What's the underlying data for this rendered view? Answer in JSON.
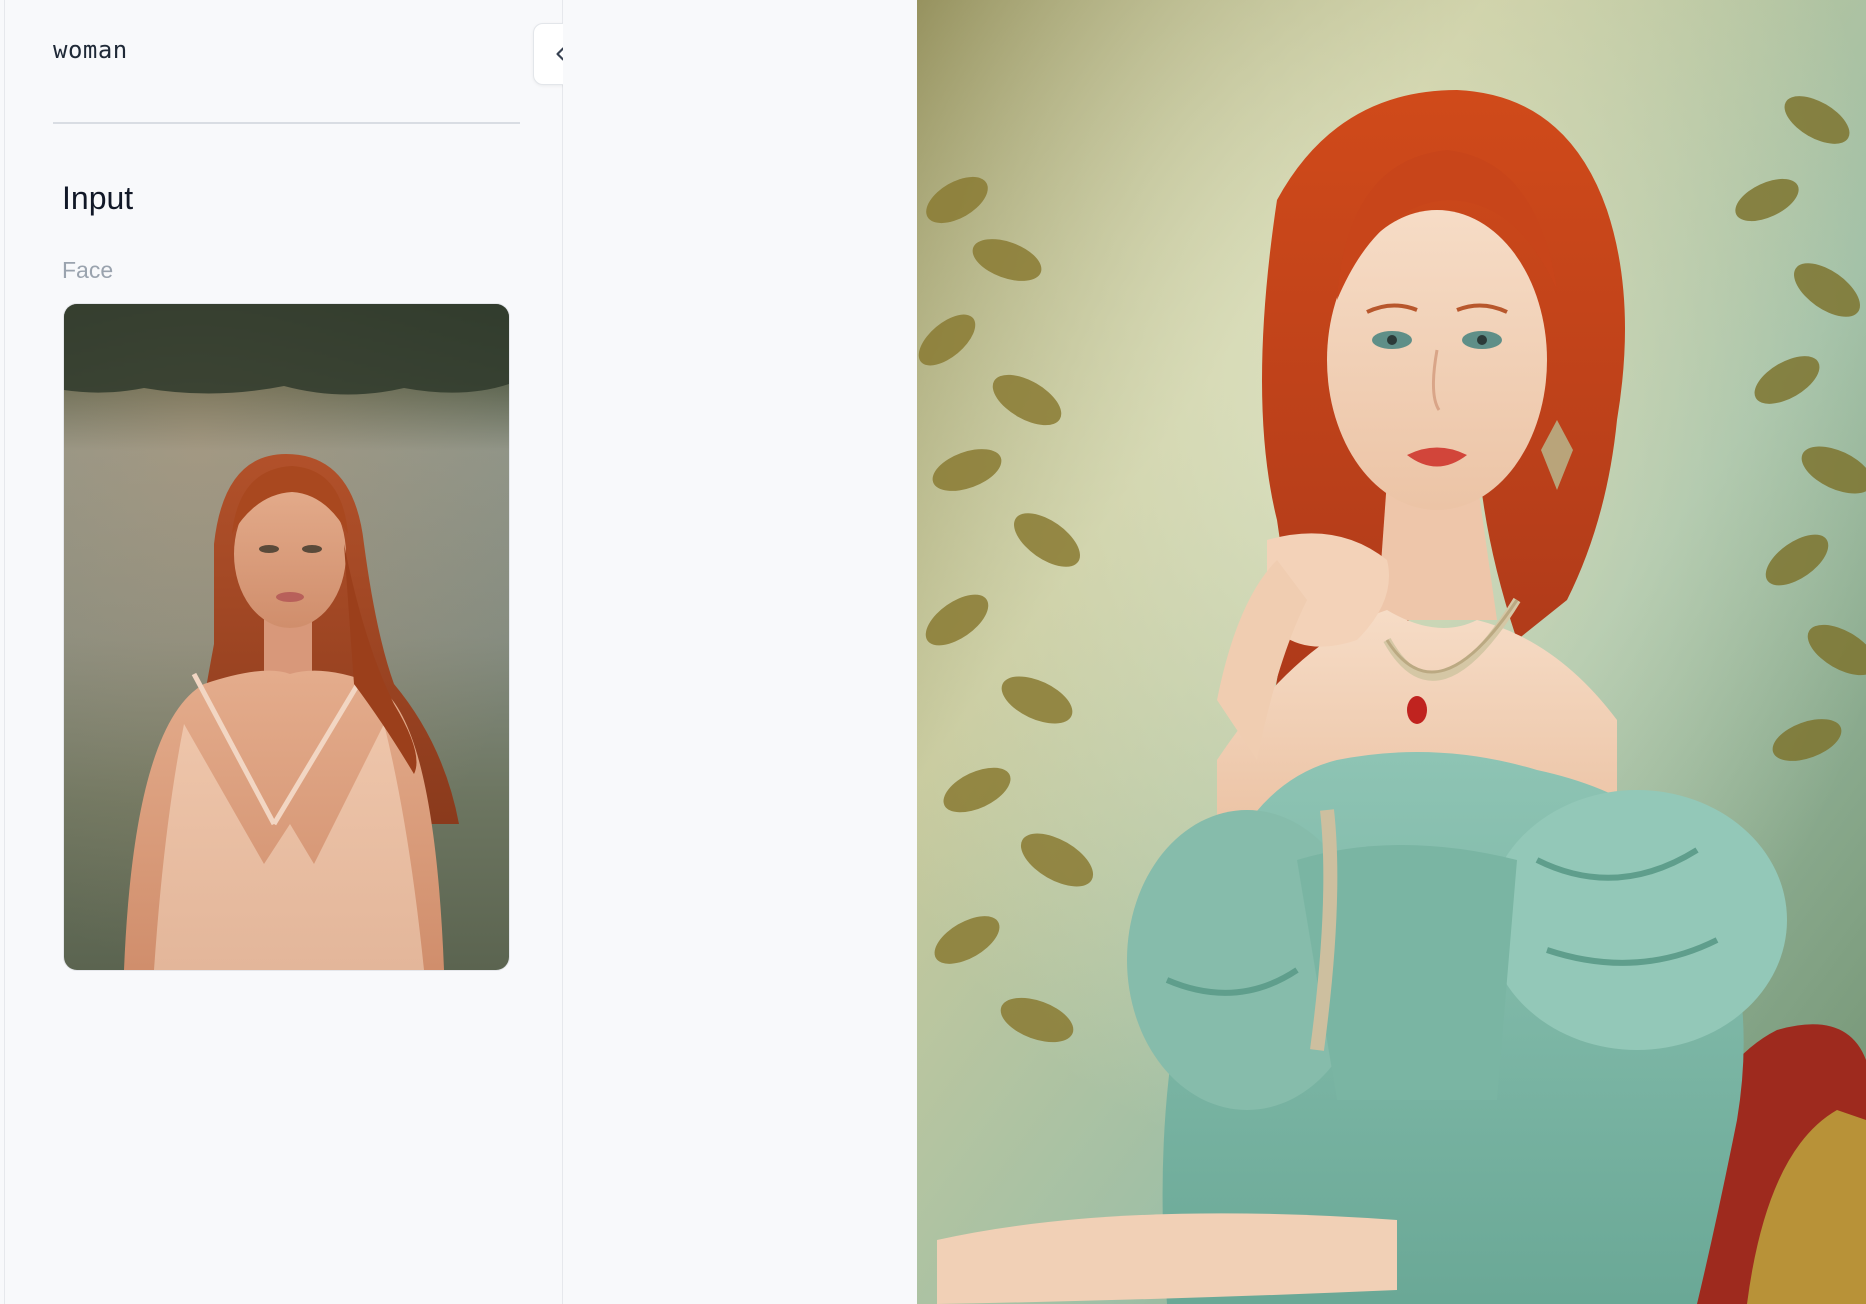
{
  "prompt": {
    "text": "woman"
  },
  "input": {
    "title": "Input",
    "face_label": "Face"
  },
  "controls": {
    "collapse_icon": "chevrons-left-icon"
  },
  "images": {
    "input_face": "photo-of-red-haired-woman-in-field",
    "output": "painting-of-red-haired-woman-in-teal-dress"
  }
}
